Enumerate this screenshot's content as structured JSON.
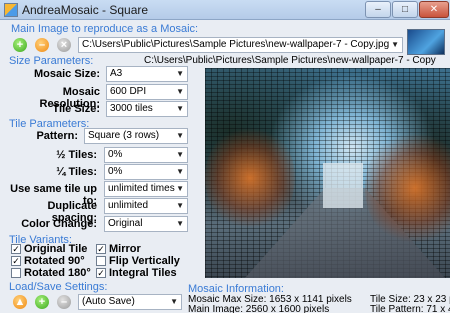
{
  "window": {
    "title": "AndreaMosaic - Square"
  },
  "main_image": {
    "section_label": "Main Image to reproduce as a Mosaic:",
    "path_value": "C:\\Users\\Public\\Pictures\\Sample Pictures\\new-wallpaper-7 - Copy.jpg",
    "path_caption": "C:\\Users\\Public\\Pictures\\Sample Pictures\\new-wallpaper-7 - Copy"
  },
  "size_parameters": {
    "section_label": "Size Parameters:",
    "mosaic_size_label": "Mosaic Size:",
    "mosaic_size_value": "A3",
    "mosaic_resolution_label": "Mosaic Resolution:",
    "mosaic_resolution_value": "600 DPI",
    "tile_size_label": "Tile Size:",
    "tile_size_value": "3000 tiles"
  },
  "tile_parameters": {
    "section_label": "Tile Parameters:",
    "pattern_label": "Pattern:",
    "pattern_value": "Square (3 rows)",
    "half_tiles_label": "½ Tiles:",
    "half_tiles_value": "0%",
    "quarter_tiles_label": "¼ Tiles:",
    "quarter_tiles_value": "0%",
    "same_tile_label": "Use same tile up to:",
    "same_tile_value": "unlimited times",
    "duplicate_label": "Duplicate spacing:",
    "duplicate_value": "unlimited",
    "color_change_label": "Color Change:",
    "color_change_value": "Original"
  },
  "tile_variants": {
    "section_label": "Tile Variants:",
    "original_tile": {
      "label": "Original Tile",
      "checked": true
    },
    "mirror": {
      "label": "Mirror",
      "checked": true
    },
    "rotated_90": {
      "label": "Rotated 90°",
      "checked": true
    },
    "flip_vertically": {
      "label": "Flip Vertically",
      "checked": false
    },
    "rotated_180": {
      "label": "Rotated 180°",
      "checked": false
    },
    "integral_tiles": {
      "label": "Integral Tiles",
      "checked": true
    }
  },
  "load_save": {
    "section_label": "Load/Save Settings:",
    "value": "(Auto Save)"
  },
  "mosaic_info": {
    "section_label": "Mosaic Information:",
    "max_size": "Mosaic Max Size: 1653 x 1141 pixels",
    "main_image": "Main Image: 2560 x 1600 pixels",
    "tile_size": "Tile Size: 23 x 23 px",
    "tile_pattern": "Tile Pattern: 71 x 4"
  },
  "icons": {
    "add": "plus-icon",
    "remove": "minus-icon",
    "clear": "close-icon",
    "dropdown": "chevron-down-icon"
  },
  "colors": {
    "accent": "#3a7bd5",
    "background": "#e9edf3"
  }
}
